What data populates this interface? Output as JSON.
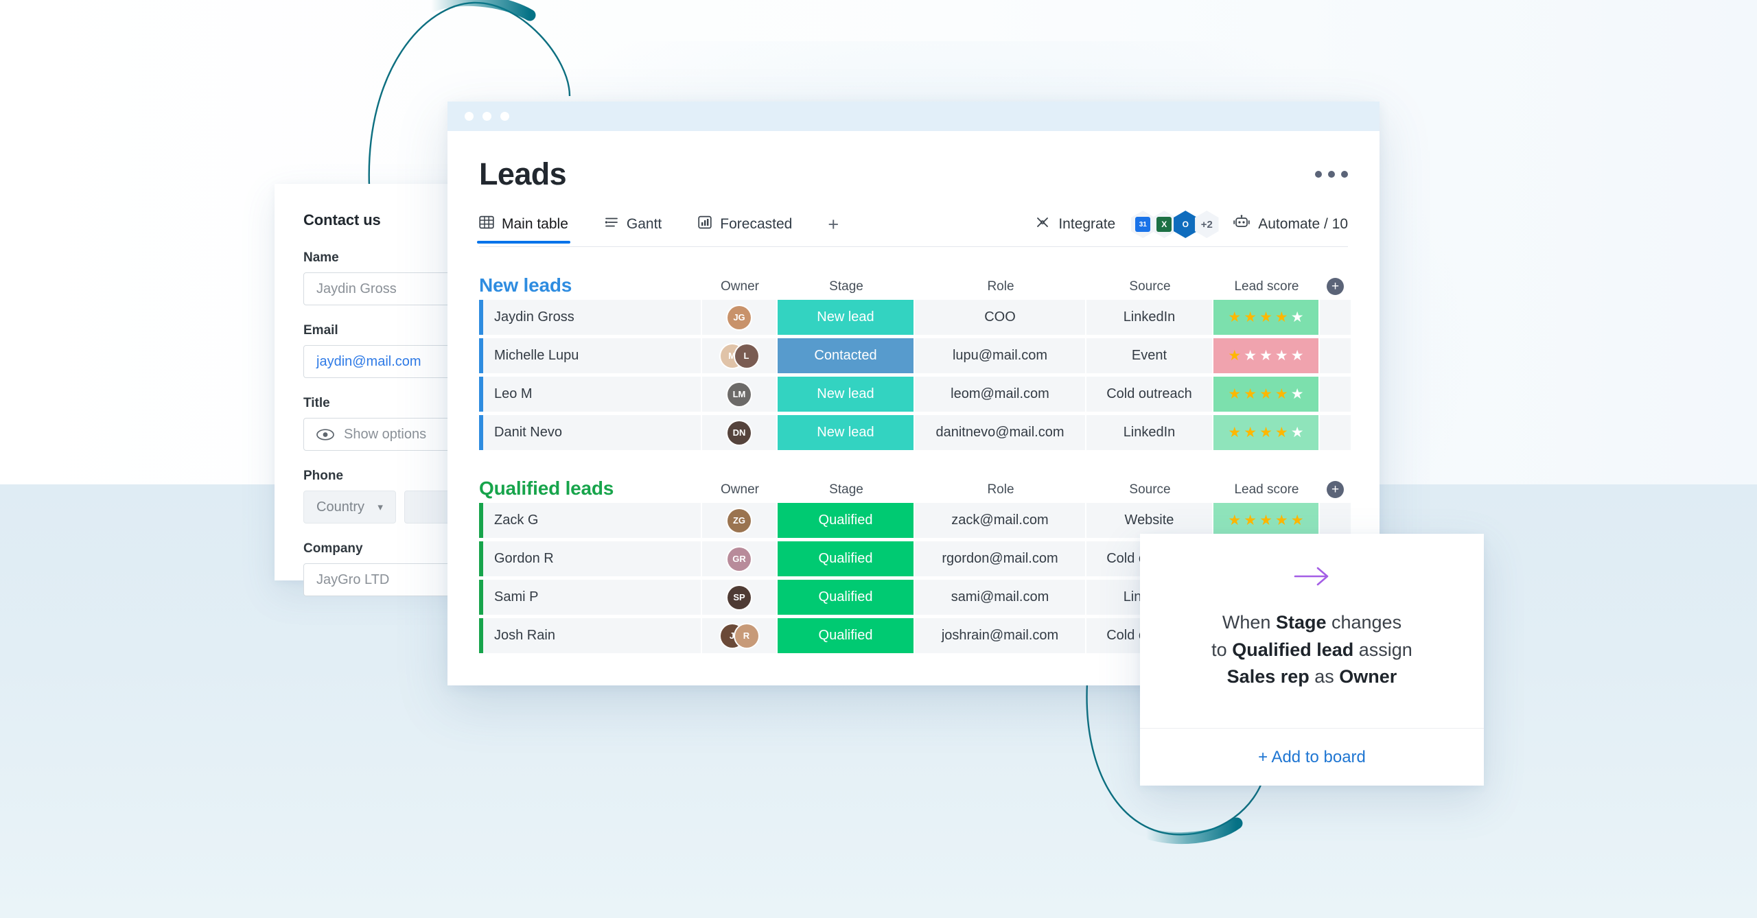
{
  "background": {
    "top_color": "#ffffff",
    "bottom_color": "#dfecf4",
    "accent_teal": "#00798a"
  },
  "contact_form": {
    "title": "Contact us",
    "fields": [
      {
        "label": "Name",
        "value": "Jaydin Gross",
        "type": "text"
      },
      {
        "label": "Email",
        "value": "jaydin@mail.com",
        "type": "email"
      },
      {
        "label": "Title",
        "value": "Show options",
        "type": "eye-select",
        "icon": "eye-icon"
      },
      {
        "label": "Phone",
        "value": "Country",
        "type": "country-select",
        "icon": "chevron-down-icon"
      },
      {
        "label": "Company",
        "value": "JayGro LTD",
        "type": "text"
      }
    ]
  },
  "board": {
    "title": "Leads",
    "window_dots": [
      "dot",
      "dot",
      "dot"
    ],
    "kebab": "more-options",
    "tabs": [
      {
        "label": "Main table",
        "icon": "table-icon",
        "active": true
      },
      {
        "label": "Gantt",
        "icon": "gantt-icon",
        "active": false
      },
      {
        "label": "Forecasted",
        "icon": "chart-icon",
        "active": false
      }
    ],
    "add_tab_label": "+",
    "integrate": {
      "label": "Integrate",
      "icon": "integrate-icon",
      "apps": [
        {
          "name": "google-calendar-icon",
          "glyph": "31",
          "color": "#1a73e8"
        },
        {
          "name": "excel-icon",
          "glyph": "X",
          "color": "#1d7044"
        },
        {
          "name": "outlook-icon",
          "glyph": "O",
          "color": "#0f6cbd"
        }
      ],
      "overflow": "+2"
    },
    "automate": {
      "label": "Automate / 10",
      "icon": "robot-icon"
    },
    "columns": [
      "Owner",
      "Stage",
      "Role",
      "Source",
      "Lead score"
    ],
    "add_column_label": "+",
    "groups": [
      {
        "name": "New leads",
        "color": "#2e8ce0",
        "rows": [
          {
            "name": "Jaydin Gross",
            "owners": [
              "JG"
            ],
            "owner_colors": [
              "#c8926a"
            ],
            "stage": "New lead",
            "stage_color": "#33d3c1",
            "role": "COO",
            "source": "LinkedIn",
            "score": 4,
            "score_bg": "#7ce0ad"
          },
          {
            "name": "Michelle Lupu",
            "owners": [
              "M",
              "L"
            ],
            "owner_colors": [
              "#e0c3a8",
              "#7a5c52"
            ],
            "stage": "Contacted",
            "stage_color": "#579bcd",
            "role": "lupu@mail.com",
            "source": "Event",
            "score": 1,
            "score_bg": "#f0a3ae"
          },
          {
            "name": "Leo M",
            "owners": [
              "LM"
            ],
            "owner_colors": [
              "#6c6a68"
            ],
            "stage": "New lead",
            "stage_color": "#33d3c1",
            "role": "leom@mail.com",
            "source": "Cold outreach",
            "score": 4,
            "score_bg": "#7ce0ad"
          },
          {
            "name": "Danit Nevo",
            "owners": [
              "DN"
            ],
            "owner_colors": [
              "#55433c"
            ],
            "stage": "New lead",
            "stage_color": "#33d3c1",
            "role": "danitnevo@mail.com",
            "source": "LinkedIn",
            "score": 4,
            "score_bg": "#8fe4bb"
          }
        ]
      },
      {
        "name": "Qualified leads",
        "color": "#17a44b",
        "rows": [
          {
            "name": "Zack G",
            "owners": [
              "ZG"
            ],
            "owner_colors": [
              "#9a7450"
            ],
            "stage": "Qualified",
            "stage_color": "#00ca72",
            "role": "zack@mail.com",
            "source": "Website",
            "score": 5,
            "score_bg": "#8fe4bb"
          },
          {
            "name": "Gordon R",
            "owners": [
              "GR"
            ],
            "owner_colors": [
              "#b88b9a"
            ],
            "stage": "Qualified",
            "stage_color": "#00ca72",
            "role": "rgordon@mail.com",
            "source": "Cold outreach",
            "score": 0,
            "score_bg": ""
          },
          {
            "name": "Sami P",
            "owners": [
              "SP"
            ],
            "owner_colors": [
              "#4e3b34"
            ],
            "stage": "Qualified",
            "stage_color": "#00ca72",
            "role": "sami@mail.com",
            "source": "LinkedIn",
            "score": 0,
            "score_bg": ""
          },
          {
            "name": "Josh Rain",
            "owners": [
              "J",
              "R"
            ],
            "owner_colors": [
              "#6b4a38",
              "#c79a78"
            ],
            "stage": "Qualified",
            "stage_color": "#00ca72",
            "role": "joshrain@mail.com",
            "source": "Cold outreach",
            "score": 0,
            "score_bg": ""
          }
        ]
      }
    ]
  },
  "automation_card": {
    "arrow_icon": "arrow-right-icon",
    "arrow_color": "#a45ee5",
    "line1_pre": "When ",
    "line1_bold": "Stage",
    "line1_post": " changes",
    "line2_pre": "to ",
    "line2_bold": "Qualified lead",
    "line2_post": " assign",
    "line3_bold1": "Sales rep",
    "line3_mid": " as ",
    "line3_bold2": "Owner",
    "footer_label": "+ Add to board"
  }
}
